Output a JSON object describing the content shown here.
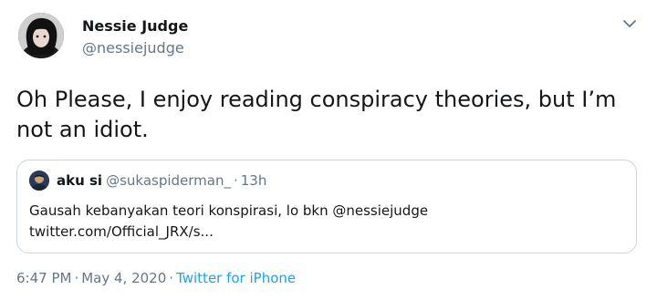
{
  "author": {
    "name": "Nessie Judge",
    "handle": "@nessiejudge"
  },
  "tweet": {
    "text": "Oh Please, I enjoy reading conspiracy theories, but I’m not an idiot."
  },
  "quoted_tweet": {
    "name": "aku si",
    "handle": "@sukaspiderman_",
    "separator": "·",
    "time": "13h",
    "text_line1": "Gausah kebanyakan teori konspirasi, lo bkn @nessiejudge",
    "text_line2": "twitter.com/Official_JRX/s..."
  },
  "meta": {
    "time": "6:47 PM",
    "separator1": "·",
    "date": "May 4, 2020",
    "separator2": "·",
    "source": "Twitter for iPhone"
  },
  "icons": {
    "caret": "chevron-down-icon"
  },
  "colors": {
    "primary_text": "#14171a",
    "secondary_text": "#657786",
    "link": "#1da1f2",
    "border": "#ccd6dd"
  }
}
